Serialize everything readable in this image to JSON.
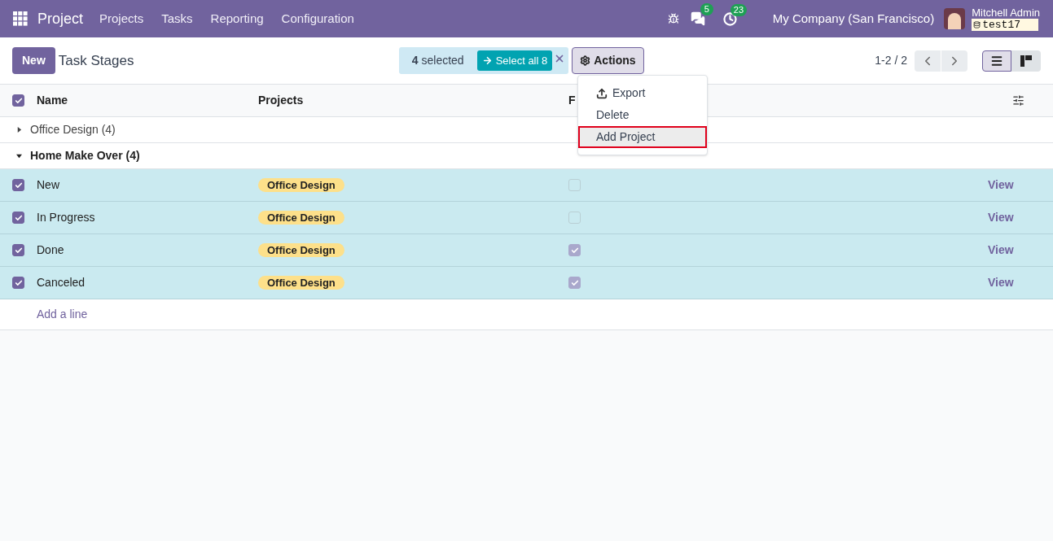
{
  "navbar": {
    "app": "Project",
    "menu": [
      "Projects",
      "Tasks",
      "Reporting",
      "Configuration"
    ],
    "messages_count": "5",
    "activities_count": "23",
    "company": "My Company (San Francisco)",
    "user": "Mitchell Admin",
    "database": "test17"
  },
  "control_panel": {
    "new_button": "New",
    "breadcrumb": "Task Stages",
    "selection_count": "4",
    "selection_label": "selected",
    "select_all": "Select all 8",
    "actions": "Actions",
    "pager": "1-2 / 2",
    "views": [
      {
        "kind": "list",
        "selected": true
      },
      {
        "kind": "kanban",
        "selected": false
      }
    ]
  },
  "actions_menu": [
    {
      "label": "Export",
      "kind": "export",
      "selected": false
    },
    {
      "label": "Delete",
      "kind": "plain",
      "selected": false
    },
    {
      "label": "Add Project",
      "kind": "plain",
      "selected": true
    }
  ],
  "table": {
    "all_checked": true,
    "columns": [
      "Name",
      "Projects",
      "F"
    ],
    "groups": [
      {
        "label": "Office Design (4)",
        "expanded": false
      },
      {
        "label": "Home Make Over (4)",
        "expanded": true,
        "rows": [
          {
            "name": "New",
            "project": "Office Design",
            "checked": true,
            "folded": false,
            "action": "View"
          },
          {
            "name": "In Progress",
            "project": "Office Design",
            "checked": true,
            "folded": false,
            "action": "View"
          },
          {
            "name": "Done",
            "project": "Office Design",
            "checked": true,
            "folded": true,
            "action": "View"
          },
          {
            "name": "Canceled",
            "project": "Office Design",
            "checked": true,
            "folded": true,
            "action": "View"
          }
        ]
      }
    ],
    "add_line": "Add a line"
  }
}
